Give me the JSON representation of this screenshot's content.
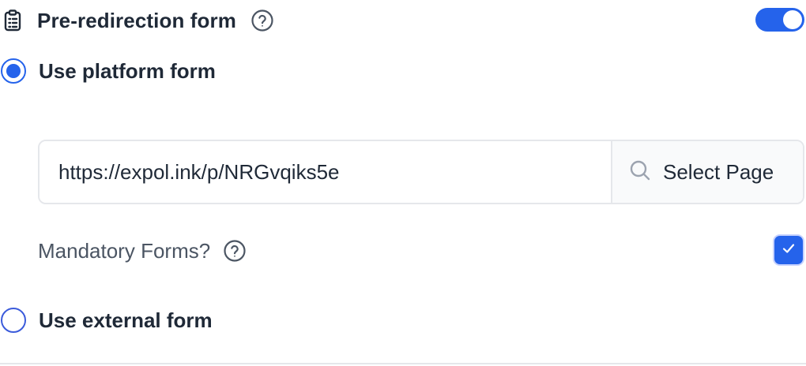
{
  "header": {
    "title": "Pre-redirection form",
    "enabled": true
  },
  "options": {
    "platform": {
      "label": "Use platform form",
      "selected": true
    },
    "external": {
      "label": "Use external form",
      "selected": false
    }
  },
  "page_selector": {
    "url": "https://expol.ink/p/NRGvqiks5e",
    "button_label": "Select Page"
  },
  "mandatory": {
    "label": "Mandatory Forms?",
    "checked": true
  },
  "icons": {
    "form": "clipboard-icon",
    "help": "help-circle-icon",
    "search": "search-icon",
    "check": "check-icon"
  },
  "colors": {
    "accent": "#2563eb",
    "border": "#e5e7eb",
    "text": "#1f2937",
    "muted_text": "#4b5563"
  }
}
